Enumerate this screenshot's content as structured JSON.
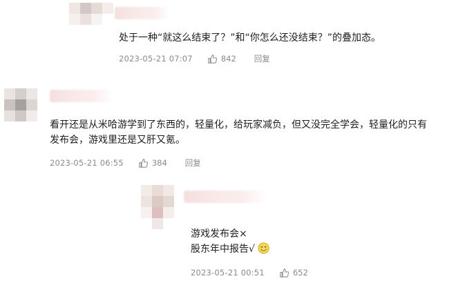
{
  "comments": [
    {
      "text_lines": [
        "处于一种“就这么结束了？”和“你怎么还没结束？”的叠加态。"
      ],
      "time": "2023-05-21 07:07",
      "likes": "842",
      "reply_label": "回复"
    },
    {
      "text_lines": [
        "看开还是从米哈游学到了东西的，轻量化，给玩家减负，但又没完全学会，轻量化的只有",
        "发布会，游戏里还是又肝又氪。"
      ],
      "time": "2023-05-21 06:55",
      "likes": "384",
      "reply_label": "回复"
    },
    {
      "text_lines": [
        "游戏发布会×",
        "股东年中报告√"
      ],
      "time": "2023-05-21 00:51",
      "likes": "652",
      "reply_label": ""
    }
  ],
  "icons": {
    "like": "thumbs-up-icon",
    "emoji": "smile-emoji-icon"
  },
  "colors": {
    "text": "#1e1e1e",
    "meta": "#8a8a8a",
    "name_blur": "#f6dede"
  }
}
